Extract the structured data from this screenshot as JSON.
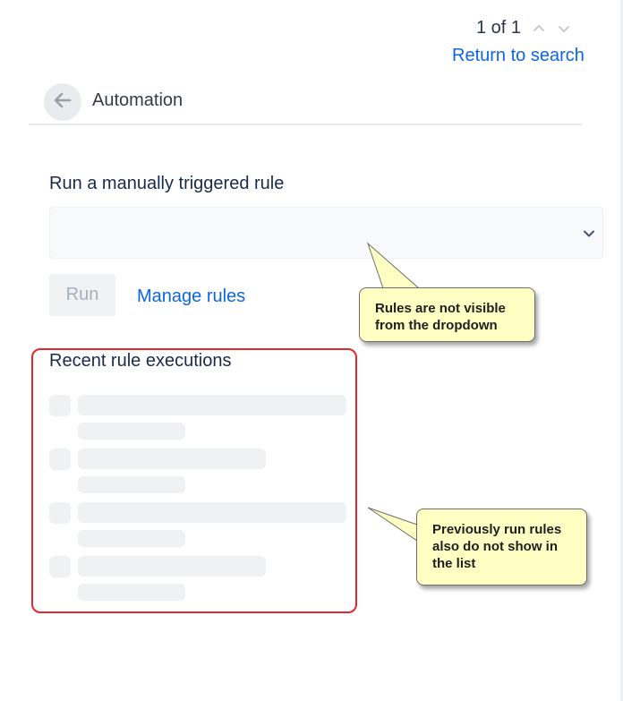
{
  "pager": {
    "text": "1 of 1",
    "prev_icon": "chevron-up-icon",
    "next_icon": "chevron-down-icon"
  },
  "return_link": "Return to search",
  "header": {
    "title": "Automation",
    "back_icon": "arrow-left-icon"
  },
  "rules": {
    "title": "Run a manually triggered rule",
    "select_value": "",
    "select_icon": "chevron-down-icon",
    "run_label": "Run",
    "manage_label": "Manage rules"
  },
  "recent": {
    "title": "Recent rule executions"
  },
  "annotations": {
    "note1": [
      "Rules are not visible",
      "from the dropdown"
    ],
    "note2": [
      "Previously run rules",
      "also do not show in",
      "the list"
    ]
  },
  "colors": {
    "link": "#0c66e4",
    "note_bg": "#ffffc4",
    "frame": "#e0292e"
  }
}
